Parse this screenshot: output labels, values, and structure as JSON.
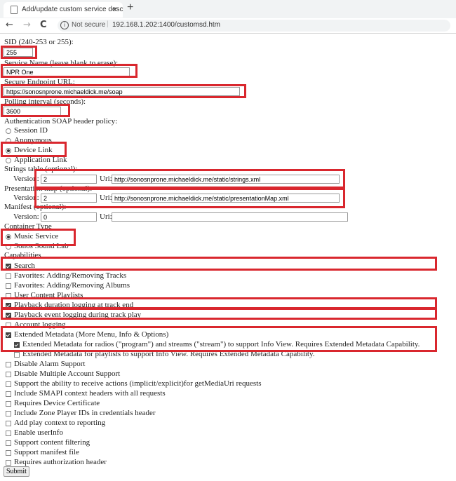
{
  "browser": {
    "tab_title": "Add/update custom service desc",
    "tab_close": "×",
    "new_tab": "+",
    "back": "←",
    "forward": "→",
    "reload": "C",
    "security": "Not secure",
    "url": "192.168.1.202:1400/customsd.htm"
  },
  "form": {
    "sid_label": "SID (240-253 or 255):",
    "sid_value": "255",
    "name_label": "Service Name (leave blank to erase):",
    "name_value": "NPR One",
    "endpoint_label": "Secure Endpoint URL:",
    "endpoint_value": "https://sonosnprone.michaeldick.me/soap",
    "polling_label": "Polling interval (seconds):",
    "polling_value": "3600",
    "auth_label": "Authentication SOAP header policy:",
    "auth_options": [
      "Session ID",
      "Anonymous",
      "Device Link",
      "Application Link"
    ],
    "auth_selected": "Device Link",
    "strings_label": "Strings table (optional):",
    "version_label": "Version:",
    "uri_label": "Uri:",
    "strings_version": "2",
    "strings_uri": "http://sonosnprone.michaeldick.me/static/strings.xml",
    "pmap_label": "Presentation map (optional):",
    "pmap_version": "2",
    "pmap_uri": "http://sonosnprone.michaeldick.me/static/presentationMap.xml",
    "manifest_label": "Manifest (optional):",
    "manifest_version": "0",
    "manifest_uri": "",
    "container_label": "Container Type",
    "container_options": [
      "Music Service",
      "Sonos Sound Lab"
    ],
    "container_selected": "Music Service",
    "capabilities_label": "Capabilities",
    "capabilities": [
      {
        "label": "Search",
        "checked": true
      },
      {
        "label": "Favorites: Adding/Removing Tracks",
        "checked": false
      },
      {
        "label": "Favorites: Adding/Removing Albums",
        "checked": false
      },
      {
        "label": "User Content Playlists",
        "checked": false
      },
      {
        "label": "Playback duration logging at track end",
        "checked": true
      },
      {
        "label": "Playback event logging during track play",
        "checked": true
      },
      {
        "label": "Account logging",
        "checked": false
      },
      {
        "label": "Extended Metadata (More Menu, Info & Options)",
        "checked": true
      },
      {
        "label": "Extended Metadata for radios (\"program\") and streams (\"stream\") to support Info View. Requires Extended Metadata Capability.",
        "checked": true,
        "indent": true
      },
      {
        "label": "Extended Metadata for playlists to support Info View. Requires Extended Metadata Capability.",
        "checked": false,
        "indent": true
      },
      {
        "label": "Disable Alarm Support",
        "checked": false
      },
      {
        "label": "Disable Multiple Account Support",
        "checked": false
      },
      {
        "label": "Support the ability to receive actions (implicit/explicit)for getMediaUri requests",
        "checked": false
      },
      {
        "label": "Include SMAPI context headers with all requests",
        "checked": false
      },
      {
        "label": "Requires Device Certificate",
        "checked": false
      },
      {
        "label": "Include Zone Player IDs in credentials header",
        "checked": false
      },
      {
        "label": "Add play context to reporting",
        "checked": false
      },
      {
        "label": "Enable userInfo",
        "checked": false
      },
      {
        "label": "Support content filtering",
        "checked": false
      },
      {
        "label": "Support manifest file",
        "checked": false
      },
      {
        "label": "Requires authorization header",
        "checked": false
      }
    ],
    "submit_label": "Submit"
  },
  "colors": {
    "highlight": "#d9272e"
  }
}
